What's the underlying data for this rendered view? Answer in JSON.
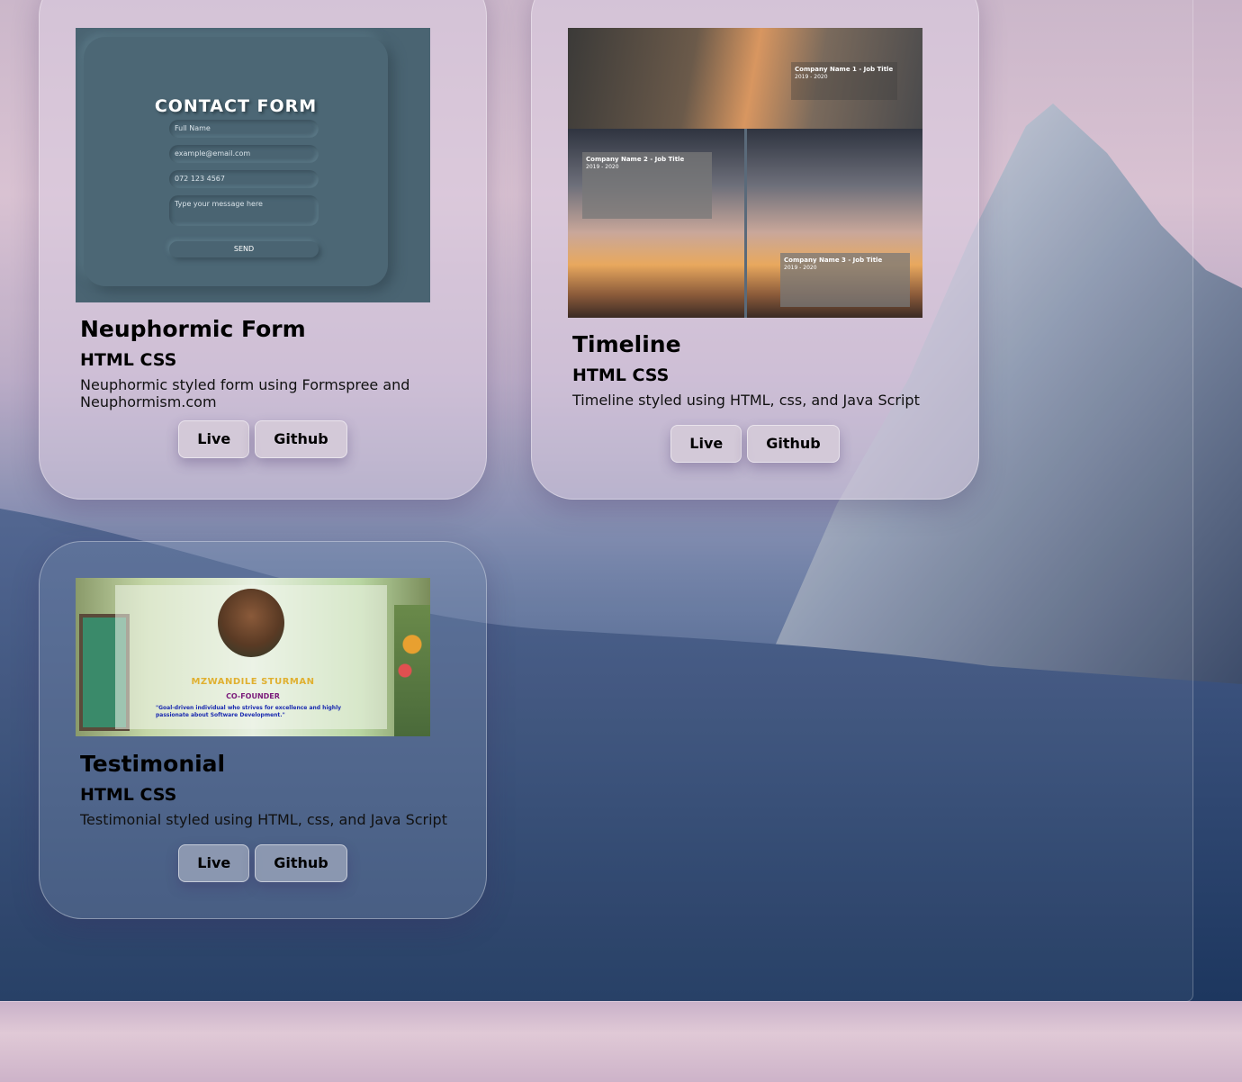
{
  "projects": [
    {
      "title": "Neuphormic Form",
      "tech": "HTML CSS",
      "description": "Neuphormic styled form using Formspree and Neuphormism.com",
      "live_label": "Live",
      "github_label": "Github",
      "preview": {
        "heading": "CONTACT FORM",
        "fields": [
          "Full Name",
          "example@email.com",
          "072 123 4567",
          "Type your message here"
        ],
        "send_label": "SEND"
      }
    },
    {
      "title": "Timeline",
      "tech": "HTML CSS",
      "description": "Timeline styled using HTML, css, and Java Script",
      "live_label": "Live",
      "github_label": "Github",
      "preview": {
        "entries": [
          {
            "title": "Company Name 1 - Job Title",
            "years": "2019 - 2020"
          },
          {
            "title": "Company Name 2 - Job Title",
            "years": "2019 - 2020"
          },
          {
            "title": "Company Name 3 - Job Title",
            "years": "2019 - 2020"
          }
        ]
      }
    },
    {
      "title": "Testimonial",
      "tech": "HTML CSS",
      "description": "Testimonial styled using HTML, css, and Java Script",
      "live_label": "Live",
      "github_label": "Github",
      "preview": {
        "name": "MZWANDILE STURMAN",
        "role": "CO-FOUNDER",
        "quote": "\"Goal-driven individual who strives for excellence and highly passionate about Software Development.\""
      }
    }
  ]
}
